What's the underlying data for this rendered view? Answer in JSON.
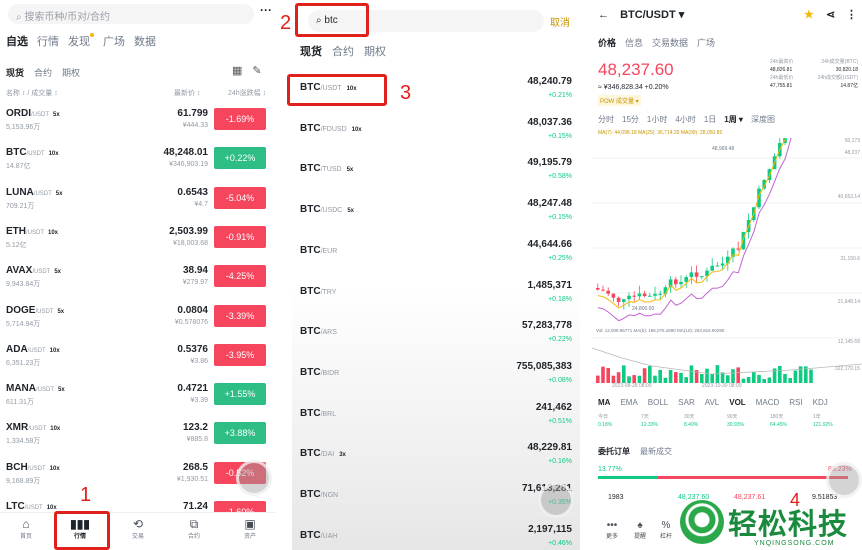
{
  "p1": {
    "search_placeholder": "搜索币种/币对/合约",
    "more": "···",
    "tabs": [
      "自选",
      "行情",
      "发现",
      "广场",
      "数据"
    ],
    "subtabs": [
      "现货",
      "合约",
      "期权"
    ],
    "col_name": "名称 ↕ / 成交量 ↕",
    "col_price": "最新价 ↕",
    "col_change": "24h涨跌幅 ↕",
    "rows": [
      {
        "sym": "ORDI",
        "quote": "/USDT",
        "lev": "5x",
        "vol": "5,153.96万",
        "price": "61.799",
        "cny": "¥444.33",
        "chg": "-1.69%",
        "up": false
      },
      {
        "sym": "BTC",
        "quote": "/USDT",
        "lev": "10x",
        "vol": "14.87亿",
        "price": "48,248.01",
        "cny": "¥346,903.19",
        "chg": "+0.22%",
        "up": true
      },
      {
        "sym": "LUNA",
        "quote": "/USDT",
        "lev": "5x",
        "vol": "709.21万",
        "price": "0.6543",
        "cny": "¥4.7",
        "chg": "-5.04%",
        "up": false
      },
      {
        "sym": "ETH",
        "quote": "/USDT",
        "lev": "10x",
        "vol": "5.12亿",
        "price": "2,503.99",
        "cny": "¥18,003.68",
        "chg": "-0.91%",
        "up": false
      },
      {
        "sym": "AVAX",
        "quote": "/USDT",
        "lev": "5x",
        "vol": "9,943.84万",
        "price": "38.94",
        "cny": "¥279.97",
        "chg": "-4.25%",
        "up": false
      },
      {
        "sym": "DOGE",
        "quote": "/USDT",
        "lev": "5x",
        "vol": "5,714.94万",
        "price": "0.0804",
        "cny": "¥0.578076",
        "chg": "-3.39%",
        "up": false
      },
      {
        "sym": "ADA",
        "quote": "/USDT",
        "lev": "10x",
        "vol": "6,351.23万",
        "price": "0.5376",
        "cny": "¥3.86",
        "chg": "-3.95%",
        "up": false
      },
      {
        "sym": "MANA",
        "quote": "/USDT",
        "lev": "5x",
        "vol": "611.31万",
        "price": "0.4721",
        "cny": "¥3.39",
        "chg": "+1.55%",
        "up": true
      },
      {
        "sym": "XMR",
        "quote": "/USDT",
        "lev": "10x",
        "vol": "1,334.58万",
        "price": "123.2",
        "cny": "¥885.8",
        "chg": "+3.88%",
        "up": true
      },
      {
        "sym": "BCH",
        "quote": "/USDT",
        "lev": "10x",
        "vol": "9,168.89万",
        "price": "268.5",
        "cny": "¥1,930.51",
        "chg": "-0.52%",
        "up": false
      },
      {
        "sym": "LTC",
        "quote": "/USDT",
        "lev": "10x",
        "vol": "",
        "price": "71.24",
        "cny": "",
        "chg": "-1.60%",
        "up": false
      }
    ],
    "nav": [
      "首页",
      "行情",
      "交易",
      "合约",
      "资产"
    ]
  },
  "p2": {
    "search_value": "btc",
    "cancel": "取消",
    "tabs": [
      "现货",
      "合约",
      "期权"
    ],
    "rows": [
      {
        "sym": "BTC",
        "quote": "/USDT",
        "lev": "10x",
        "price": "48,240.79",
        "chg": "+0.21%"
      },
      {
        "sym": "BTC",
        "quote": "/FDUSD",
        "lev": "10x",
        "price": "48,037.36",
        "chg": "+0.15%"
      },
      {
        "sym": "BTC",
        "quote": "/TUSD",
        "lev": "5x",
        "price": "49,195.79",
        "chg": "+0.58%"
      },
      {
        "sym": "BTC",
        "quote": "/USDC",
        "lev": "5x",
        "price": "48,247.48",
        "chg": "+0.15%"
      },
      {
        "sym": "BTC",
        "quote": "/EUR",
        "lev": "",
        "price": "44,644.66",
        "chg": "+0.25%"
      },
      {
        "sym": "BTC",
        "quote": "/TRY",
        "lev": "",
        "price": "1,485,371",
        "chg": "+0.18%"
      },
      {
        "sym": "BTC",
        "quote": "/ARS",
        "lev": "",
        "price": "57,283,778",
        "chg": "+0.22%"
      },
      {
        "sym": "BTC",
        "quote": "/BIDR",
        "lev": "",
        "price": "755,085,383",
        "chg": "+0.08%"
      },
      {
        "sym": "BTC",
        "quote": "/BRL",
        "lev": "",
        "price": "241,462",
        "chg": "+0.51%"
      },
      {
        "sym": "BTC",
        "quote": "/DAI",
        "lev": "3x",
        "price": "48,229.81",
        "chg": "+0.16%"
      },
      {
        "sym": "BTC",
        "quote": "/NGN",
        "lev": "",
        "price": "71,613,281",
        "chg": "+0.35%"
      },
      {
        "sym": "BTC",
        "quote": "/UAH",
        "lev": "",
        "price": "2,197,115",
        "chg": "+0.46%"
      }
    ]
  },
  "p3": {
    "back": "←",
    "pair": "BTC/USDT",
    "tabs": [
      "价格",
      "信息",
      "交易数据",
      "广场"
    ],
    "price": "48,237.60",
    "cny_line": "≈ ¥346,828.34  +0.20%",
    "pow": "POW  成交量 ▾",
    "stats": [
      [
        "24h最高价",
        "24h成交量(BTC)"
      ],
      [
        "48,826.81",
        "30,820.18"
      ],
      [
        "24h最低价",
        "24h成交额(USDT)"
      ],
      [
        "47,755.81",
        "14.87亿"
      ]
    ],
    "timeframes": [
      "分时",
      "15分",
      "1小时",
      "4小时",
      "1日",
      "1周 ▾",
      "深度图"
    ],
    "ma_line": "MA(7): 44,098.18   MA(25): 36,714.35   MA(99): 28,050.85",
    "chart_labels": {
      "high": "48,969.48",
      "low": "24,800.00",
      "date1": "2023-08-28 08:00",
      "date2": "2023-10-30 08:00",
      "vol_line": "Vol: 12,009.86771   MA(5): 186,075.2890   MA(10): 253,816.90290"
    },
    "axis": [
      "50,173",
      "48,237",
      "40,653.14",
      "31,150.6",
      "21,648.14",
      "12,145.68",
      "322,170.15"
    ],
    "indicators": [
      "MA",
      "EMA",
      "BOLL",
      "SAR",
      "AVL",
      "VOL",
      "MACD",
      "RSI",
      "KDJ"
    ],
    "ind_values": [
      [
        "今日",
        "7天",
        "30天",
        "90天",
        "180天",
        "1年"
      ],
      [
        "0.18%",
        "12.33%",
        "8.49%",
        "30.93%",
        "64.45%",
        "121.92%"
      ]
    ],
    "ob_tabs": [
      "委托订单",
      "最新成交"
    ],
    "ob_pct": "13.77%",
    "ob_pct_r": "86.23%",
    "ob_row": [
      "1983",
      "48,237.60",
      "48,237.61",
      "9.51853"
    ],
    "nav": [
      "更多",
      "提醒",
      "杠杆"
    ]
  },
  "annotations": [
    "1",
    "2",
    "3",
    "4"
  ],
  "watermark": {
    "title": "轻松科技",
    "url": "YNQINGSONG.COM"
  },
  "colors": {
    "red": "#f6465d",
    "green": "#0ecb81",
    "accent": "#f0b90b"
  }
}
